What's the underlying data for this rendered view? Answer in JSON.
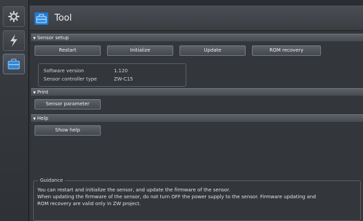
{
  "window": {
    "title": "Tool"
  },
  "sidebar": {
    "items": [
      {
        "icon": "gear-icon"
      },
      {
        "icon": "lightning-icon"
      },
      {
        "icon": "toolbox-icon"
      }
    ]
  },
  "sections": {
    "sensor_setup": {
      "header": "Sensor setup",
      "buttons": {
        "restart": "Restart",
        "initialize": "Initialize",
        "update": "Update",
        "rom_recovery": "ROM recovery"
      },
      "info": {
        "software_version_label": "Software version",
        "software_version_value": "1.120",
        "controller_type_label": "Sensor controller type",
        "controller_type_value": "ZW-C15"
      }
    },
    "print": {
      "header": "Print",
      "button": "Sensor parameter"
    },
    "help": {
      "header": "Help",
      "button": "Show help"
    }
  },
  "guidance": {
    "title": "Guidance",
    "line1": "You can restart and initialize the sensor, and update the firmware of the sensor.",
    "line2": "When updating the firmware of the sensor, do not turn OFF the power supply to the sensor. Firmware updating and",
    "line3": "ROM recovery are valid only in ZW project."
  },
  "colors": {
    "accent": "#1e7ad1",
    "background": "#33363a"
  }
}
